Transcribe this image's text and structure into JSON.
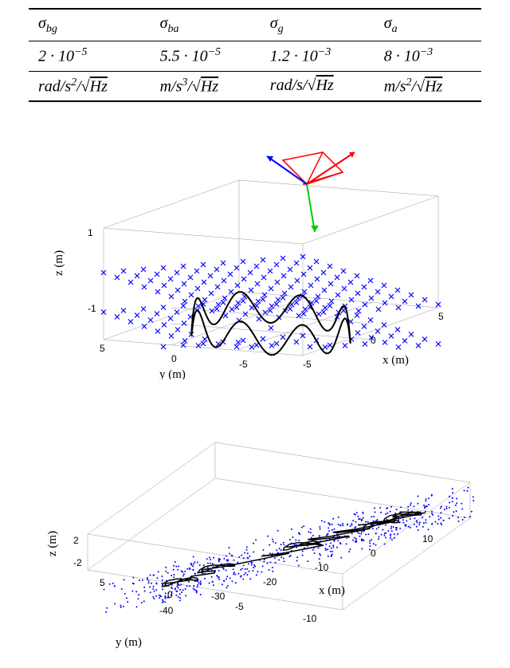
{
  "table": {
    "headers": [
      "σ_bg",
      "σ_ba",
      "σ_g",
      "σ_a"
    ],
    "values": [
      "2 · 10^−5",
      "5.5 · 10^−5",
      "1.2 · 10^−3",
      "8 · 10^−3"
    ],
    "units": [
      "rad/s²/√Hz",
      "m/s³/√Hz",
      "rad/s/√Hz",
      "m/s²/√Hz"
    ]
  },
  "figure_top": {
    "xlabel": "x (m)",
    "ylabel": "y (m)",
    "zlabel": "z (m)",
    "x_ticks": [
      "-5",
      "0",
      "5"
    ],
    "y_ticks": [
      "-5",
      "0",
      "5"
    ],
    "z_ticks": [
      "-1",
      "1"
    ]
  },
  "figure_bottom": {
    "xlabel": "x (m)",
    "ylabel": "y (m)",
    "zlabel": "z (m)",
    "x_ticks": [
      "-40",
      "-30",
      "-20",
      "-10",
      "0",
      "10"
    ],
    "y_ticks": [
      "-10",
      "-5",
      "0",
      "5"
    ],
    "z_ticks": [
      "-2",
      "2"
    ]
  },
  "chart_data": [
    {
      "type": "scatter",
      "title": "Top 3D plot: wavy circular trajectory with landmark grid",
      "xlabel": "x (m)",
      "ylabel": "y (m)",
      "zlabel": "z (m)",
      "xlim": [
        -5,
        5
      ],
      "ylim": [
        -5,
        5
      ],
      "zlim": [
        -1,
        1.5
      ],
      "series": [
        {
          "name": "landmarks",
          "marker": "x",
          "color": "#0000FF",
          "description": "Regular grid of blue x-markers across y from -5 to 5, x from -5 to 5, z from about -1 to 1.5 (approx spacing 1)"
        },
        {
          "name": "trajectory",
          "marker": "line",
          "color": "#000000",
          "description": "Black wavy closed loop roughly circular radius ~3.5 centered near origin, z oscillating between about -0.5 and 0.5"
        },
        {
          "name": "camera_frustum",
          "marker": "line",
          "color": "#FF0000",
          "description": "Red wireframe pyramid at approx (2,2.5,0.8)"
        },
        {
          "name": "axes",
          "description": "Coordinate axes at camera position: red, green, blue arrows"
        }
      ]
    },
    {
      "type": "scatter",
      "title": "Bottom 3D plot: long trajectory with scattered landmarks",
      "xlabel": "x (m)",
      "ylabel": "y (m)",
      "zlabel": "z (m)",
      "xlim": [
        -45,
        10
      ],
      "ylim": [
        -10,
        5
      ],
      "zlim": [
        -2,
        2
      ],
      "series": [
        {
          "name": "landmarks",
          "marker": ".",
          "color": "#0000FF",
          "description": "Dense blue point cloud scattered along the trajectory, clustered in several regions from x≈-45 to x≈10"
        },
        {
          "name": "trajectory",
          "marker": "line",
          "color": "#000000",
          "description": "Black path extending from x≈10 to x≈-45 with local loops and spurs, mostly near z≈0"
        }
      ]
    }
  ]
}
